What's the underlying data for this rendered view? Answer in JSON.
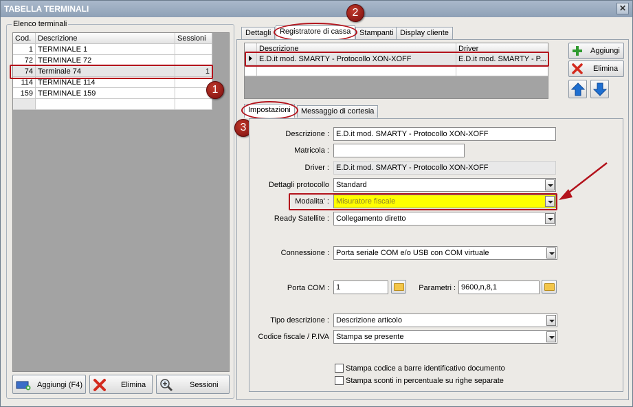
{
  "window": {
    "title": "TABELLA TERMINALI",
    "close_glyph": "✕"
  },
  "left": {
    "group_label": "Elenco terminali",
    "columns": [
      "Cod.",
      "Descrizione",
      "Sessioni"
    ],
    "rows": [
      {
        "cod": "1",
        "descrizione": "TERMINALE 1",
        "sessioni": ""
      },
      {
        "cod": "72",
        "descrizione": "TERMINALE 72",
        "sessioni": ""
      },
      {
        "cod": "74",
        "descrizione": "Terminale 74",
        "sessioni": "1"
      },
      {
        "cod": "114",
        "descrizione": "TERMINALE 114",
        "sessioni": ""
      },
      {
        "cod": "159",
        "descrizione": "TERMINALE 159",
        "sessioni": ""
      }
    ],
    "buttons": {
      "add": "Aggiungi (F4)",
      "delete": "Elimina",
      "sessions": "Sessioni"
    }
  },
  "tabs": [
    "Dettagli",
    "Registratore di cassa",
    "Stampanti",
    "Display cliente"
  ],
  "register_grid": {
    "columns": [
      "Descrizione",
      "Driver"
    ],
    "row": {
      "descrizione": "E.D.it mod. SMARTY - Protocollo XON-XOFF",
      "driver": "E.D.it mod. SMARTY - P..."
    }
  },
  "right_buttons": {
    "add": "Aggiungi",
    "delete": "Elimina"
  },
  "subtabs": [
    "Impostazioni",
    "Messaggio di cortesia"
  ],
  "form": {
    "descrizione_label": "Descrizione :",
    "descrizione_value": "E.D.it mod. SMARTY - Protocollo XON-XOFF",
    "matricola_label": "Matricola :",
    "matricola_value": "",
    "driver_label": "Driver :",
    "driver_value": "E.D.it mod. SMARTY - Protocollo XON-XOFF",
    "dettagli_label": "Dettagli protocollo",
    "dettagli_value": "Standard",
    "modalita_label": "Modalita' :",
    "modalita_value": "Misuratore fiscale",
    "ready_label": "Ready Satellite :",
    "ready_value": "Collegamento diretto",
    "connessione_label": "Connessione :",
    "connessione_value": "Porta seriale COM e/o USB con COM virtuale",
    "porta_label": "Porta COM :",
    "porta_value": "1",
    "parametri_label": "Parametri :",
    "parametri_value": "9600,n,8,1",
    "tipo_label": "Tipo descrizione :",
    "tipo_value": "Descrizione articolo",
    "codice_label": "Codice fiscale / P.IVA",
    "codice_value": "Stampa se presente",
    "check1_label": "Stampa codice a barre identificativo documento",
    "check2_label": "Stampa sconti in percentuale su righe separate"
  },
  "badges": [
    "1",
    "2",
    "3"
  ],
  "colors": {
    "highlight_yellow": "#ffff00",
    "annotation_red": "#b3121b",
    "arrow_blue": "#1e6fd1"
  }
}
